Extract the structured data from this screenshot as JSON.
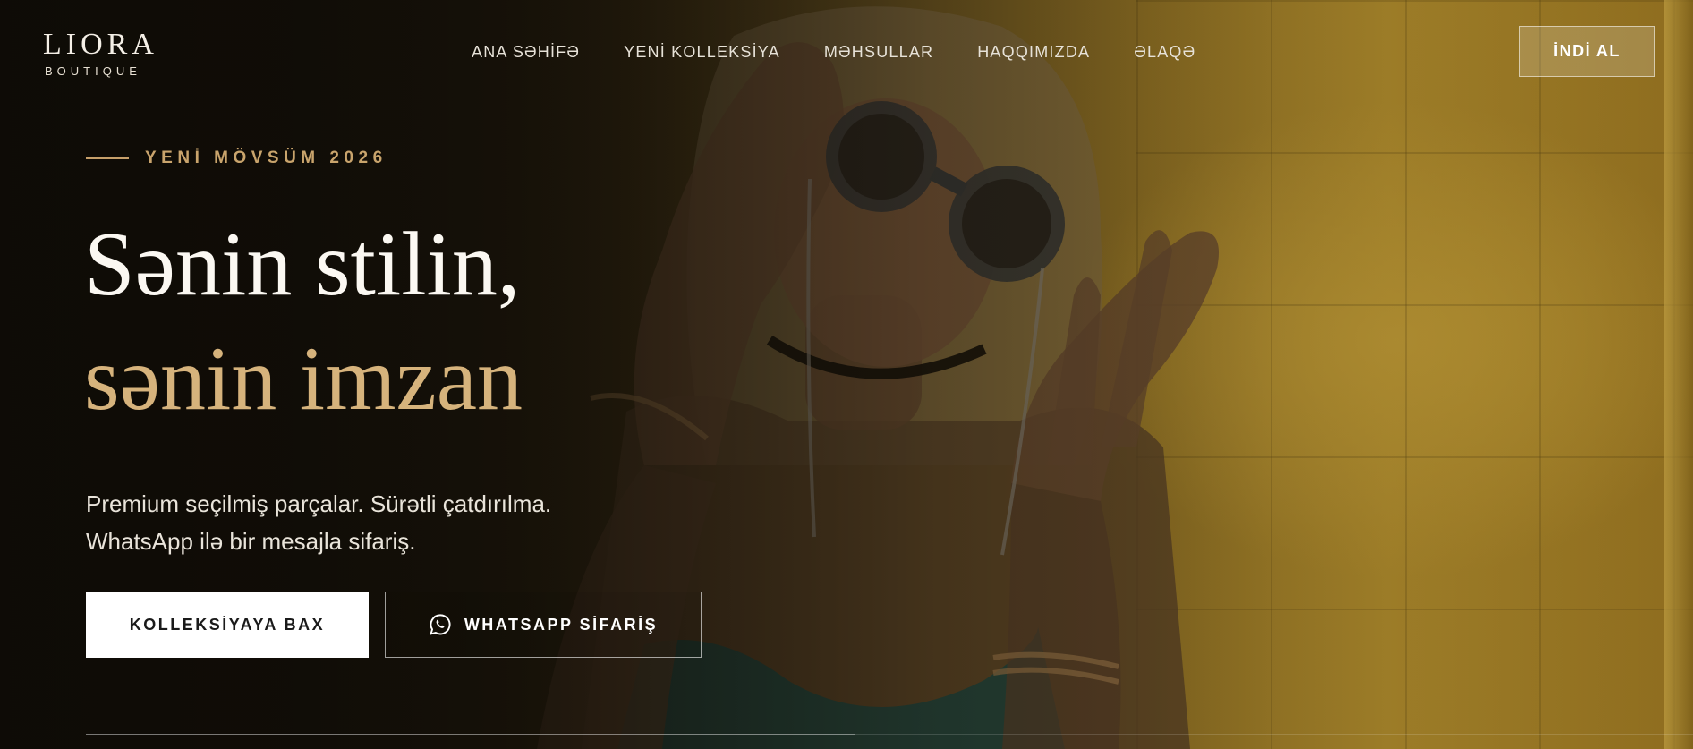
{
  "brand": {
    "name": "LIORA",
    "tagline": "BOUTIQUE"
  },
  "nav": {
    "items": [
      {
        "label": "ANA SƏHİFƏ"
      },
      {
        "label": "YENİ KOLLEKSİYA"
      },
      {
        "label": "MƏHSULLAR"
      },
      {
        "label": "HAQQIMIZDA"
      },
      {
        "label": "ƏLAQƏ"
      }
    ],
    "cta_label": "İNDİ AL"
  },
  "hero": {
    "eyebrow": "YENİ MÖVSÜM 2026",
    "headline_line1": "Sənin stilin,",
    "headline_line2": "sənin imzan",
    "subcopy_line1": "Premium seçilmiş parçalar. Sürətli çatdırılma.",
    "subcopy_line2": "WhatsApp ilə bir mesajla sifariş.",
    "primary_button": "KOLLEKSİYAYA BAX",
    "secondary_button": "WHATSAPP SİFARİŞ",
    "secondary_button_icon": "whatsapp-icon"
  },
  "colors": {
    "accent_gold": "#d6b37c",
    "eyebrow_gold": "#c9a46c",
    "background_dark": "#1a150c"
  }
}
